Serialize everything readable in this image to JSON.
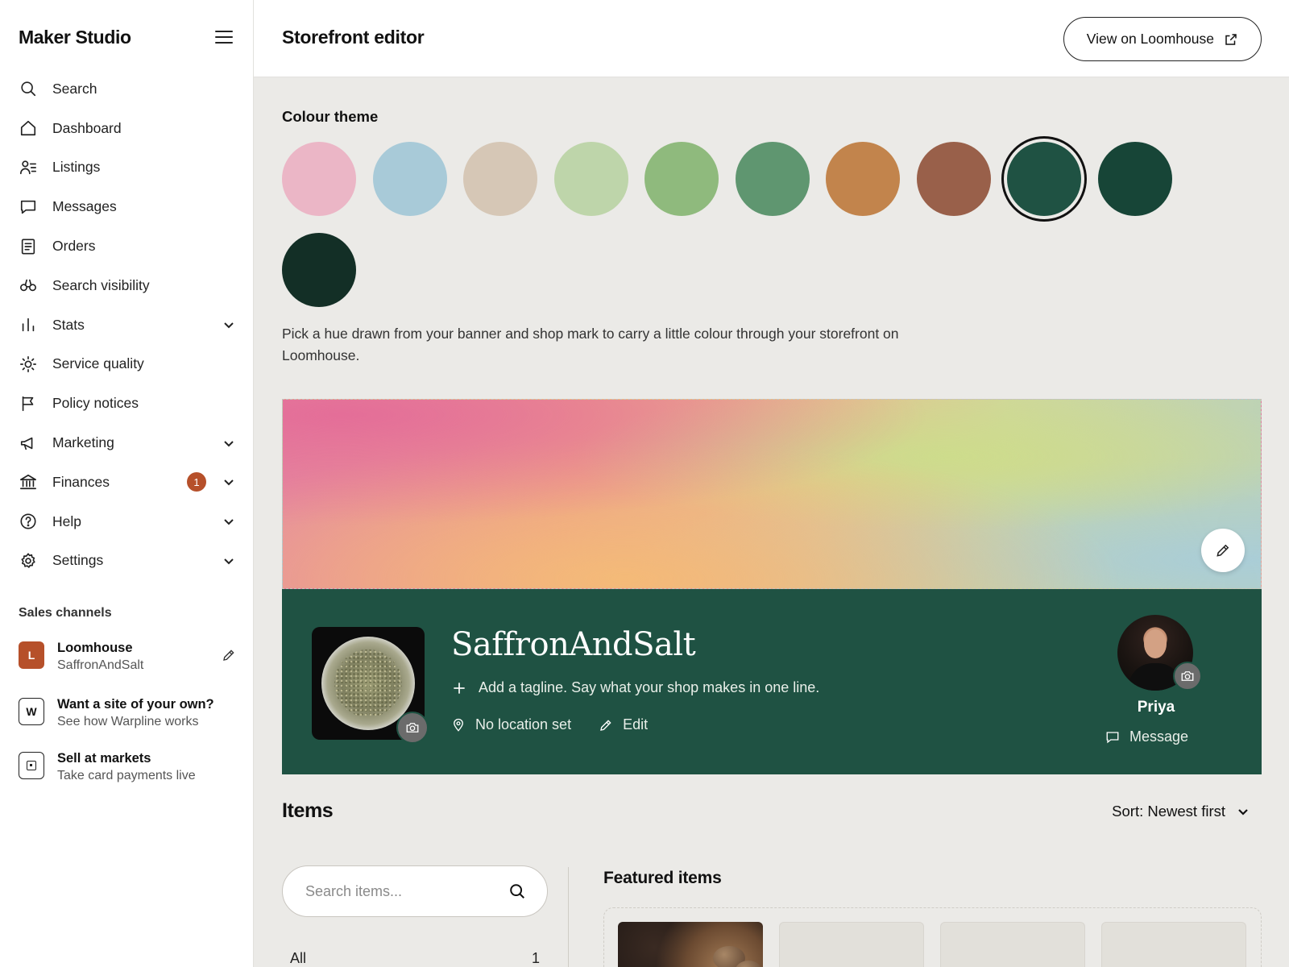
{
  "sidebar": {
    "brand": "Maker Studio",
    "nav": [
      {
        "label": "Search",
        "icon": "search-icon"
      },
      {
        "label": "Dashboard",
        "icon": "home-icon"
      },
      {
        "label": "Listings",
        "icon": "listings-icon"
      },
      {
        "label": "Messages",
        "icon": "message-icon"
      },
      {
        "label": "Orders",
        "icon": "orders-icon"
      },
      {
        "label": "Search visibility",
        "icon": "binoculars-icon"
      },
      {
        "label": "Stats",
        "icon": "bar-chart-icon",
        "expandable": true
      },
      {
        "label": "Service quality",
        "icon": "sun-icon"
      },
      {
        "label": "Policy notices",
        "icon": "flag-icon"
      },
      {
        "label": "Marketing",
        "icon": "megaphone-icon",
        "expandable": true
      },
      {
        "label": "Finances",
        "icon": "bank-icon",
        "expandable": true,
        "badge": "1"
      },
      {
        "label": "Help",
        "icon": "help-icon",
        "expandable": true
      },
      {
        "label": "Settings",
        "icon": "gear-icon",
        "expandable": true
      }
    ],
    "sales_channels_title": "Sales channels",
    "channels": [
      {
        "avatar": "L",
        "title": "Loomhouse",
        "subtitle": "SaffronAndSalt"
      },
      {
        "avatar": "W",
        "title": "Want a site of your own?",
        "subtitle": "See how Warpline works"
      },
      {
        "avatar": "",
        "title": "Sell at markets",
        "subtitle": "Take card payments live"
      }
    ]
  },
  "header": {
    "title": "Storefront editor",
    "view_button": "View on Loomhouse"
  },
  "theme": {
    "title": "Colour theme",
    "swatches": [
      "#ebb6c6",
      "#a8cad8",
      "#d6c7b6",
      "#bed5aa",
      "#8fba7d",
      "#5f9670",
      "#c2844c",
      "#99604a",
      "#1f5243",
      "#174537",
      "#132f26"
    ],
    "selected_index": 8,
    "helper_text": "Pick a hue drawn from your banner and shop mark to carry a little colour through your storefront on Loomhouse."
  },
  "shop": {
    "name": "SaffronAndSalt",
    "tagline_prompt": "Add a tagline. Say what your shop makes in one line.",
    "location": "No location set",
    "location_edit": "Edit",
    "owner_name": "Priya",
    "message_label": "Message",
    "accent_color": "#1f5243"
  },
  "items": {
    "title": "Items",
    "sort_label": "Sort: Newest first",
    "search_placeholder": "Search items...",
    "categories": [
      {
        "label": "All",
        "count": "1"
      }
    ],
    "featured_title": "Featured items"
  }
}
